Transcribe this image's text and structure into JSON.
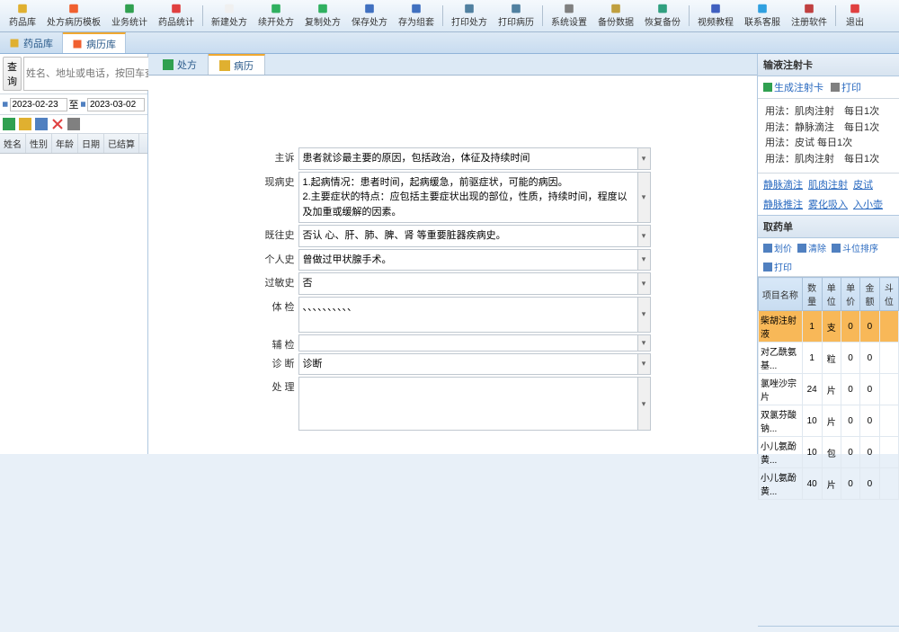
{
  "toolbar": [
    {
      "name": "drug-lib",
      "label": "药品库",
      "color": "#e0b030"
    },
    {
      "name": "rx-template",
      "label": "处方病历模板",
      "color": "#f06030"
    },
    {
      "name": "biz-stats",
      "label": "业务统计",
      "color": "#30a050"
    },
    {
      "name": "drug-stats",
      "label": "药品统计",
      "color": "#e04040"
    },
    {
      "name": "new-rx",
      "label": "新建处方",
      "color": "#f0f0f0"
    },
    {
      "name": "cont-rx",
      "label": "续开处方",
      "color": "#30b060"
    },
    {
      "name": "copy-rx",
      "label": "复制处方",
      "color": "#30b060"
    },
    {
      "name": "save-rx",
      "label": "保存处方",
      "color": "#4070c0"
    },
    {
      "name": "save-draft",
      "label": "存为组套",
      "color": "#4070c0"
    },
    {
      "name": "print-rx",
      "label": "打印处方",
      "color": "#5080a0"
    },
    {
      "name": "print-record",
      "label": "打印病历",
      "color": "#5080a0"
    },
    {
      "name": "sys-settings",
      "label": "系统设置",
      "color": "#808080"
    },
    {
      "name": "backup",
      "label": "备份数据",
      "color": "#c0a040"
    },
    {
      "name": "restore",
      "label": "恢复备份",
      "color": "#30a080"
    },
    {
      "name": "tutorial",
      "label": "视频教程",
      "color": "#4060c0"
    },
    {
      "name": "contact",
      "label": "联系客服",
      "color": "#30a0e0"
    },
    {
      "name": "register",
      "label": "注册软件",
      "color": "#c04040"
    },
    {
      "name": "exit",
      "label": "退出",
      "color": "#e04040"
    }
  ],
  "left": {
    "tabs": [
      "药品库",
      "病历库"
    ],
    "active_tab": 1,
    "search_label": "查询",
    "search_placeholder": "姓名、地址或电话，按回车查询",
    "date_from": "2023-02-23",
    "date_to": "2023-03-02",
    "to_label": "至",
    "cols": [
      "姓名",
      "性别",
      "年龄",
      "日期",
      "已结算"
    ]
  },
  "center": {
    "tabs": [
      "处方",
      "病历"
    ],
    "active_tab": 1,
    "fields": {
      "zhusu_label": "主诉",
      "zhusu": "患者就诊最主要的原因，包括政治，体征及持续时间",
      "xbs_label": "现病史",
      "xbs": "1.起病情况：患者时间，起病缓急，前驱症状，可能的病因。\n2.主要症状的特点：应包括主要症状出现的部位，性质，持续时间，程度以及加重或缓解的因素。",
      "jws_label": "既往史",
      "jws": "否认 心、肝、肺、脾、肾 等重要脏器疾病史。",
      "grs_label": "个人史",
      "grs": "曾做过甲状腺手术。",
      "gms_label": "过敏史",
      "gms": "否",
      "tj_label": "体 检",
      "tj": "、、、、、、、、、、",
      "fj_label": "辅 检",
      "fj": "",
      "zd_label": "诊 断",
      "zd": "诊断",
      "cl_label": "处 理",
      "cl": ""
    }
  },
  "right": {
    "card_title": "输液注射卡",
    "gen_card": "生成注射卡",
    "print": "打印",
    "usages": [
      "用法：肌肉注射　每日1次",
      "用法：静脉滴注　每日1次",
      "用法：皮试 每日1次",
      "用法：肌肉注射　每日1次"
    ],
    "tab_links": [
      "静脉滴注",
      "肌肉注射",
      "皮试",
      "静脉推注",
      "雾化吸入",
      "入小壶"
    ],
    "med_title": "取药单",
    "med_actions": [
      "划价",
      "清除",
      "斗位排序",
      "打印"
    ],
    "med_cols": [
      "项目名称",
      "数量",
      "单位",
      "单价",
      "金额",
      "斗位"
    ],
    "med_rows": [
      {
        "name": "柴胡注射液",
        "qty": "1",
        "unit": "支",
        "price": "0",
        "amt": "0",
        "pos": "",
        "sel": true
      },
      {
        "name": "对乙酰氨基...",
        "qty": "1",
        "unit": "粒",
        "price": "0",
        "amt": "0",
        "pos": ""
      },
      {
        "name": "氯唑沙宗片",
        "qty": "24",
        "unit": "片",
        "price": "0",
        "amt": "0",
        "pos": ""
      },
      {
        "name": "双氯芬酸钠...",
        "qty": "10",
        "unit": "片",
        "price": "0",
        "amt": "0",
        "pos": ""
      },
      {
        "name": "小儿氨酚黄...",
        "qty": "10",
        "unit": "包",
        "price": "0",
        "amt": "0",
        "pos": ""
      },
      {
        "name": "小儿氨酚黄...",
        "qty": "40",
        "unit": "片",
        "price": "0",
        "amt": "0",
        "pos": ""
      }
    ]
  }
}
